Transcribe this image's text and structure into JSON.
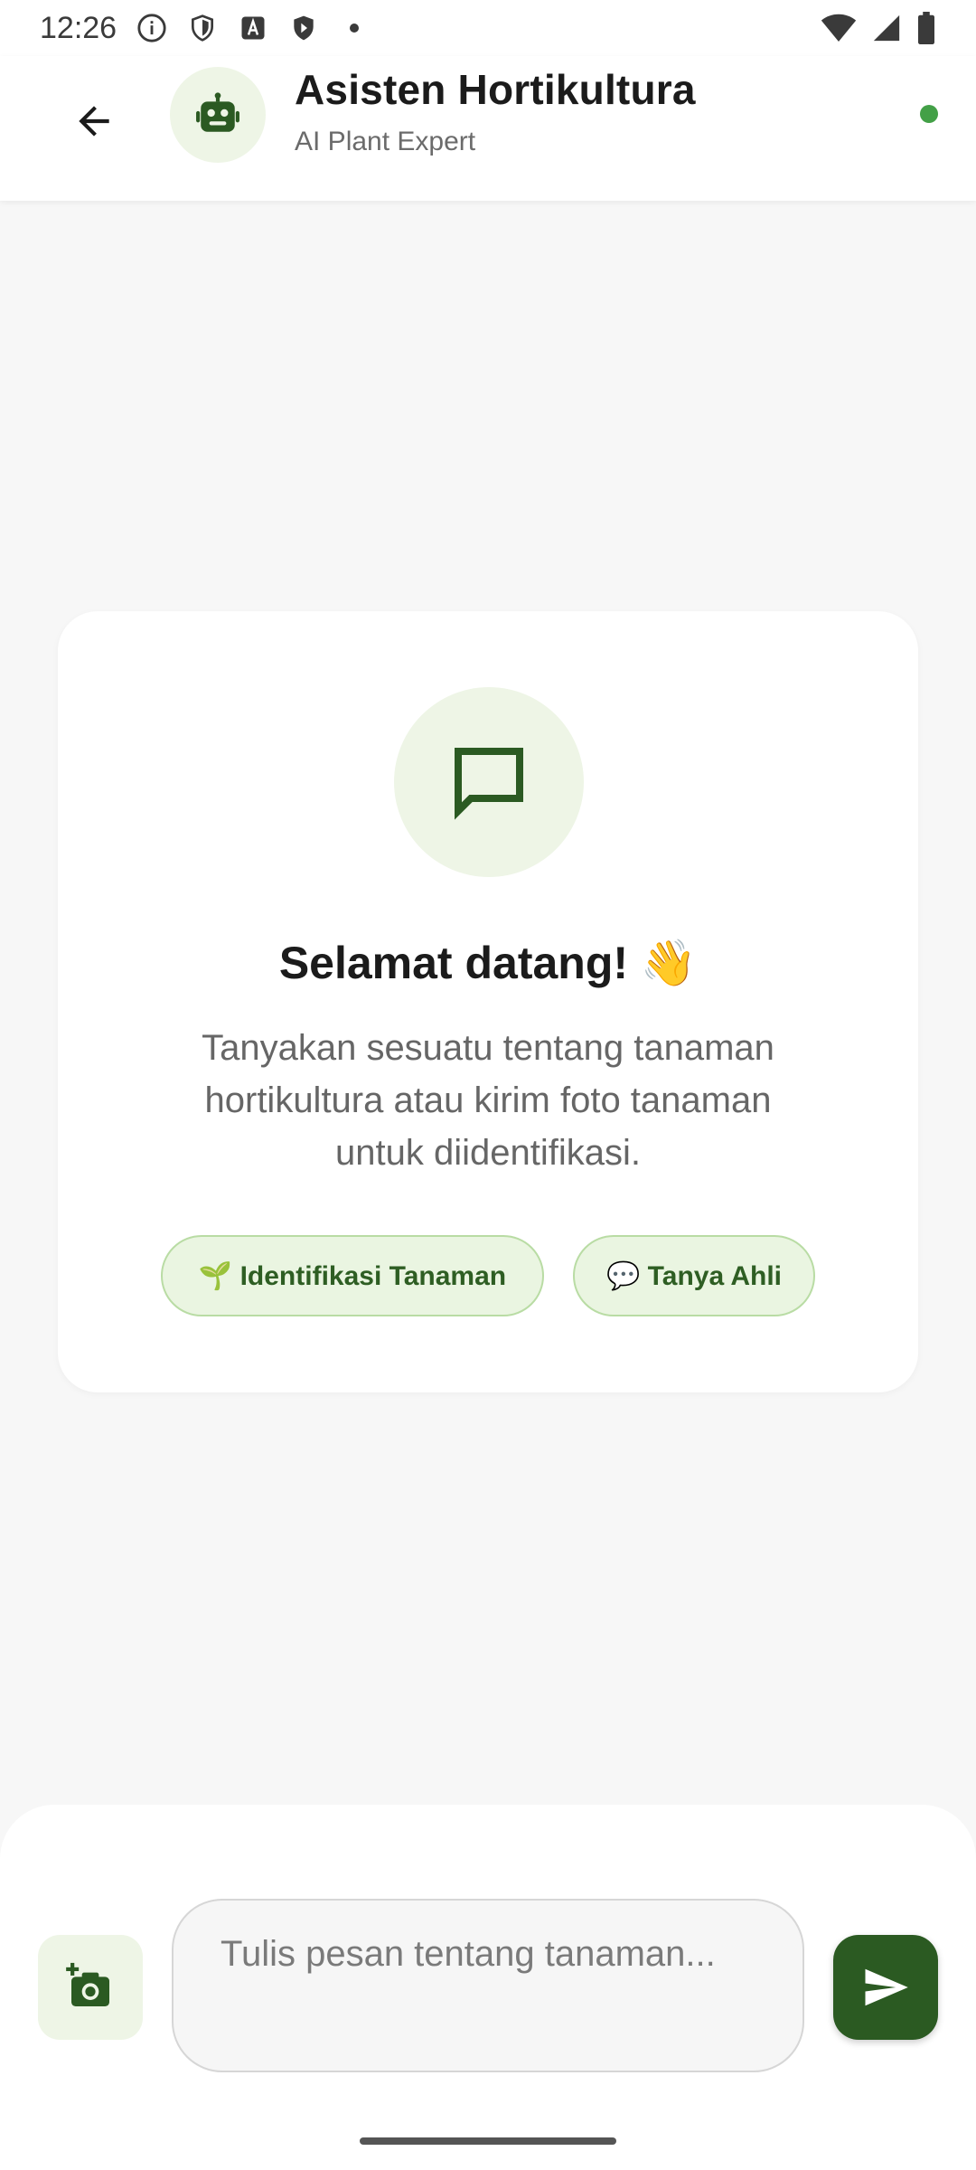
{
  "status_bar": {
    "time": "12:26",
    "icons": [
      "info-icon",
      "shield-icon",
      "font-a-icon",
      "vpn-shield-icon",
      "dot-icon",
      "wifi-icon",
      "signal-icon",
      "battery-icon"
    ]
  },
  "header": {
    "title": "Asisten Hortikultura",
    "subtitle": "AI Plant Expert",
    "status": "online",
    "colors": {
      "online": "#43a047",
      "avatar_bg": "#eef5e6",
      "accent": "#2b5a22"
    }
  },
  "welcome": {
    "title": "Selamat datang! 👋",
    "description": "Tanyakan sesuatu tentang tanaman hortikultura atau kirim foto tanaman untuk diidentifikasi.",
    "chips": [
      {
        "label": "🌱 Identifikasi Tanaman"
      },
      {
        "label": "💬 Tanya Ahli"
      }
    ]
  },
  "composer": {
    "placeholder": "Tulis pesan tentang tanaman...",
    "camera_icon": "add-photo-icon",
    "send_icon": "send-icon"
  }
}
